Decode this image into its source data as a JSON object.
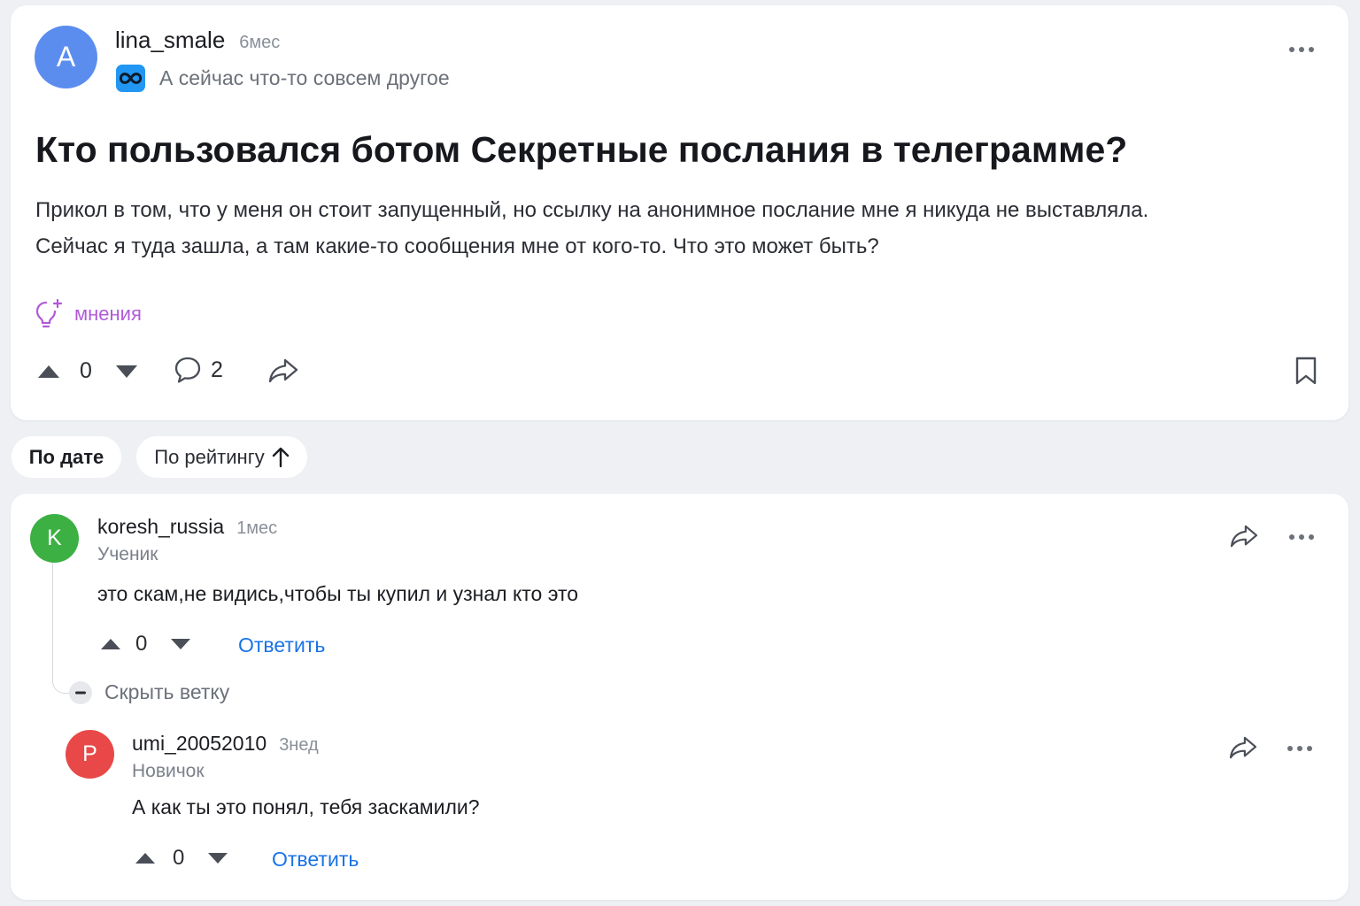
{
  "question": {
    "author": {
      "avatar_letter": "A",
      "avatar_color": "#5b8def",
      "username": "lina_smale",
      "time": "6мес",
      "status_icon": "infinity-icon",
      "status_icon_color": "#2196f3",
      "status_text": "А сейчас что-то совсем другое"
    },
    "title": "Кто пользовался ботом Секретные послания в телеграмме?",
    "body_line1": "Прикол в том, что у меня он стоит запущенный, но ссылку на анонимное послание мне я никуда не выставляла.",
    "body_line2": "Сейчас я туда зашла, а там какие-то сообщения мне от кого-то. Что это может быть?",
    "tag": {
      "icon": "lightbulb-plus-icon",
      "label": "мнения",
      "color": "#b15ad8"
    },
    "actions": {
      "vote_count": "0",
      "comment_count": "2"
    }
  },
  "sort": {
    "by_date_label": "По дате",
    "by_rating_label": "По рейтингу",
    "active": "По дате"
  },
  "answers": [
    {
      "avatar_letter": "K",
      "avatar_color": "#3cb043",
      "username": "koresh_russia",
      "time": "1мес",
      "rank": "Ученик",
      "text": "это скам,не видись,чтобы ты купил и узнал кто это",
      "vote_count": "0",
      "reply_label": "Ответить",
      "hide_thread_label": "Скрыть ветку"
    },
    {
      "avatar_letter": "P",
      "avatar_color": "#e94848",
      "username": "umi_20052010",
      "time": "3нед",
      "rank": "Новичок",
      "text": "А как ты это понял, тебя заскамили?",
      "vote_count": "0",
      "reply_label": "Ответить"
    }
  ],
  "colors": {
    "link": "#1a73e8",
    "background": "#eef0f4",
    "card": "#ffffff"
  }
}
